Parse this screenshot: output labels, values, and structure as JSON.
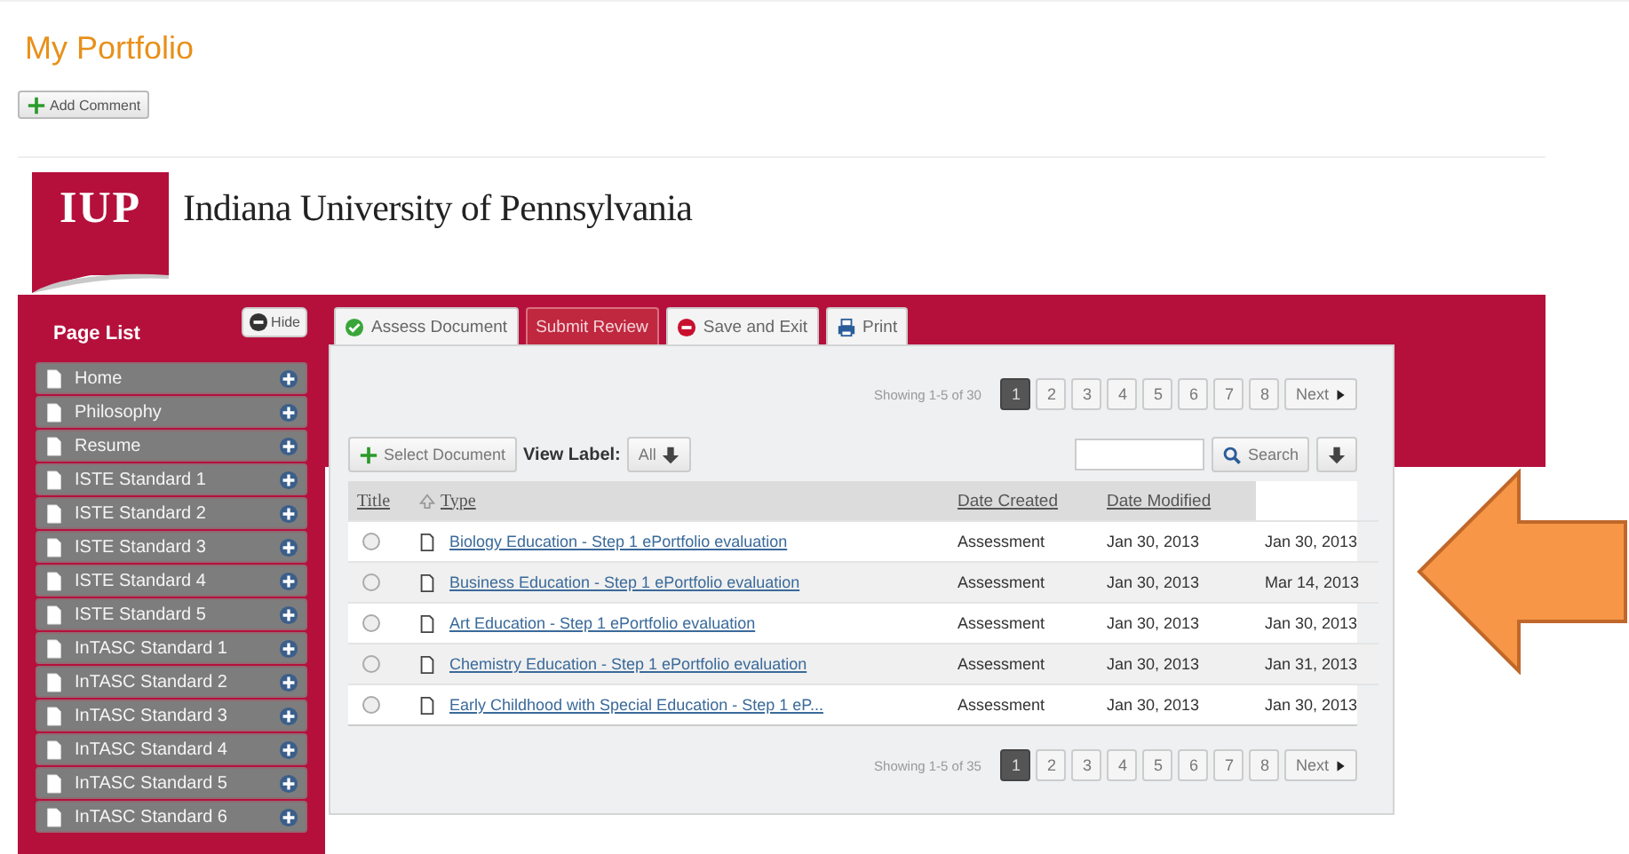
{
  "page_title": "My Portfolio",
  "add_comment_button": "Add Comment",
  "header": {
    "logo_text": "IUP",
    "institution": "Indiana University of Pennsylvania"
  },
  "sidebar": {
    "title": "Page List",
    "hide_button": "Hide",
    "items": [
      {
        "label": "Home"
      },
      {
        "label": "Philosophy"
      },
      {
        "label": "Resume"
      },
      {
        "label": "ISTE Standard 1"
      },
      {
        "label": "ISTE Standard 2"
      },
      {
        "label": "ISTE Standard 3"
      },
      {
        "label": "ISTE Standard 4"
      },
      {
        "label": "ISTE Standard 5"
      },
      {
        "label": "InTASC Standard 1"
      },
      {
        "label": "InTASC Standard 2"
      },
      {
        "label": "InTASC Standard 3"
      },
      {
        "label": "InTASC Standard 4"
      },
      {
        "label": "InTASC Standard 5"
      },
      {
        "label": "InTASC Standard 6"
      }
    ]
  },
  "action_buttons": [
    {
      "label": "Assess Document",
      "kind": "check"
    },
    {
      "label": "Submit Review",
      "kind": "primary"
    },
    {
      "label": "Save and Exit",
      "kind": "stop"
    },
    {
      "label": "Print",
      "kind": "print"
    }
  ],
  "pagination_top": {
    "summary": "Showing 1-5 of 30",
    "next": "Next",
    "pages": [
      {
        "label": "1",
        "selected": true
      },
      {
        "label": "2",
        "selected": false
      },
      {
        "label": "3",
        "selected": false
      },
      {
        "label": "4",
        "selected": false
      },
      {
        "label": "5",
        "selected": false
      },
      {
        "label": "6",
        "selected": false
      },
      {
        "label": "7",
        "selected": false
      },
      {
        "label": "8",
        "selected": false
      }
    ]
  },
  "select_document_button": "Select Document",
  "view_label": {
    "label": "View Label:",
    "value": "All"
  },
  "search": {
    "button": "Search"
  },
  "table": {
    "columns": [
      "Title",
      "Type",
      "Date Created",
      "Date Modified"
    ],
    "rows": [
      {
        "selected": false,
        "document": "Biology Education - Step 1 ePortfolio evaluation",
        "column_3": "Assessment",
        "column_4": "Jan 30, 2013",
        "column_5": "Jan 30, 2013"
      },
      {
        "selected": false,
        "document": "Business Education - Step 1 ePortfolio evaluation",
        "column_3": "Assessment",
        "column_4": "Jan 30, 2013",
        "column_5": "Mar 14, 2013"
      },
      {
        "selected": false,
        "document": "Art Education - Step 1 ePortfolio evaluation",
        "column_3": "Assessment",
        "column_4": "Jan 30, 2013",
        "column_5": "Jan 30, 2013"
      },
      {
        "selected": false,
        "document": "Chemistry Education - Step 1 ePortfolio evaluation",
        "column_3": "Assessment",
        "column_4": "Jan 30, 2013",
        "column_5": "Jan 31, 2013"
      },
      {
        "selected": false,
        "document": "Early Childhood with Special Education - Step 1 eP...",
        "column_3": "Assessment",
        "column_4": "Jan 30, 2013",
        "column_5": "Jan 30, 2013"
      }
    ]
  },
  "pagination_bottom": {
    "summary": "Showing 1-5 of 35",
    "next": "Next",
    "pages": [
      {
        "label": "1",
        "selected": true
      },
      {
        "label": "2",
        "selected": false
      },
      {
        "label": "3",
        "selected": false
      },
      {
        "label": "4",
        "selected": false
      },
      {
        "label": "5",
        "selected": false
      },
      {
        "label": "6",
        "selected": false
      },
      {
        "label": "7",
        "selected": false
      },
      {
        "label": "8",
        "selected": false
      }
    ]
  }
}
